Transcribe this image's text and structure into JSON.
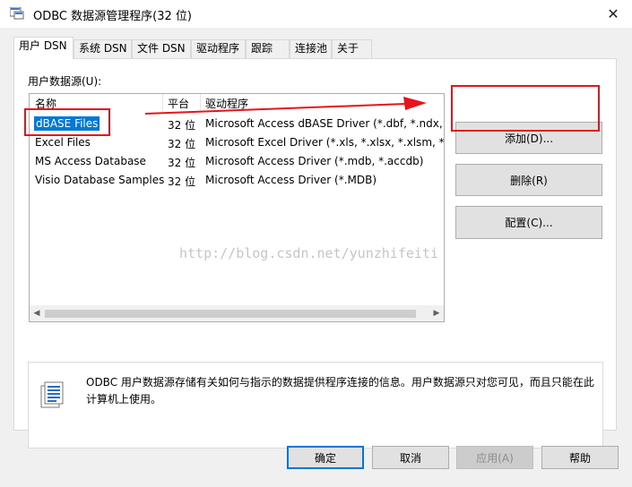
{
  "window": {
    "title": "ODBC 数据源管理程序(32 位)",
    "close_glyph": "✕"
  },
  "tabs": [
    {
      "label": "用户 DSN",
      "active": true
    },
    {
      "label": "系统 DSN",
      "active": false
    },
    {
      "label": "文件 DSN",
      "active": false
    },
    {
      "label": "驱动程序",
      "active": false
    },
    {
      "label": "跟踪",
      "active": false
    },
    {
      "label": "连接池",
      "active": false
    },
    {
      "label": "关于",
      "active": false
    }
  ],
  "user_dsn": {
    "group_label": "用户数据源(U):",
    "columns": [
      "名称",
      "平台",
      "驱动程序"
    ],
    "rows": [
      {
        "name": "dBASE Files",
        "platform": "32 位",
        "driver": "Microsoft Access dBASE Driver (*.dbf, *.ndx, *",
        "selected": true
      },
      {
        "name": "Excel Files",
        "platform": "32 位",
        "driver": "Microsoft Excel Driver (*.xls, *.xlsx, *.xlsm, *.xlsb)",
        "selected": false
      },
      {
        "name": "MS Access Database",
        "platform": "32 位",
        "driver": "Microsoft Access Driver (*.mdb, *.accdb)",
        "selected": false
      },
      {
        "name": "Visio Database Samples",
        "platform": "32 位",
        "driver": "Microsoft Access Driver (*.MDB)",
        "selected": false
      }
    ],
    "scroll_left": "◀",
    "scroll_right": "▶"
  },
  "side_buttons": {
    "add": "添加(D)...",
    "remove": "删除(R)",
    "configure": "配置(C)..."
  },
  "info": {
    "text": "ODBC 用户数据源存储有关如何与指示的数据提供程序连接的信息。用户数据源只对您可见，而且只能在此计算机上使用。"
  },
  "bottom_buttons": {
    "ok": "确定",
    "cancel": "取消",
    "apply": "应用(A)",
    "help": "帮助"
  },
  "watermark": "http://blog.csdn.net/yunzhifeiti",
  "colors": {
    "selection": "#0078d7",
    "annotation_red": "#e8141b"
  }
}
